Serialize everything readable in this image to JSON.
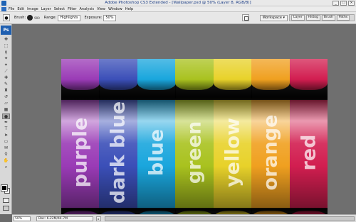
{
  "window": {
    "title": "Adobe Photoshop CS3 Extended - [Wallpaper.psd @ 50% (Layer 8, RGB/8)]",
    "controls": [
      "_",
      "□",
      "×"
    ]
  },
  "menu": {
    "items": [
      "File",
      "Edit",
      "Image",
      "Layer",
      "Select",
      "Filter",
      "Analysis",
      "View",
      "Window",
      "Help"
    ]
  },
  "options": {
    "brush_label": "Brush:",
    "brush_size": "900",
    "range_label": "Range:",
    "range_value": "Highlights",
    "exposure_label": "Exposure:",
    "exposure_value": "50%",
    "workspace_label": "Workspace ▾",
    "panel_tabs": [
      "Layer",
      "Histog",
      "Brush",
      "Paths"
    ]
  },
  "toolbox": {
    "logo": "Ps"
  },
  "canvas": {
    "stripes": [
      {
        "label": "purple",
        "color": "#9a3bb6"
      },
      {
        "label": "dark blue",
        "color": "#3b4fb8"
      },
      {
        "label": "blue",
        "color": "#1aa6dd"
      },
      {
        "label": "green",
        "color": "#a9c21f"
      },
      {
        "label": "yellow",
        "color": "#e8d22a"
      },
      {
        "label": "orange",
        "color": "#f0a020"
      },
      {
        "label": "red",
        "color": "#d21e50"
      }
    ]
  },
  "status": {
    "zoom": "50%",
    "doc_info": "Doc: 6.22M/44.7M",
    "arrow": "▸"
  }
}
